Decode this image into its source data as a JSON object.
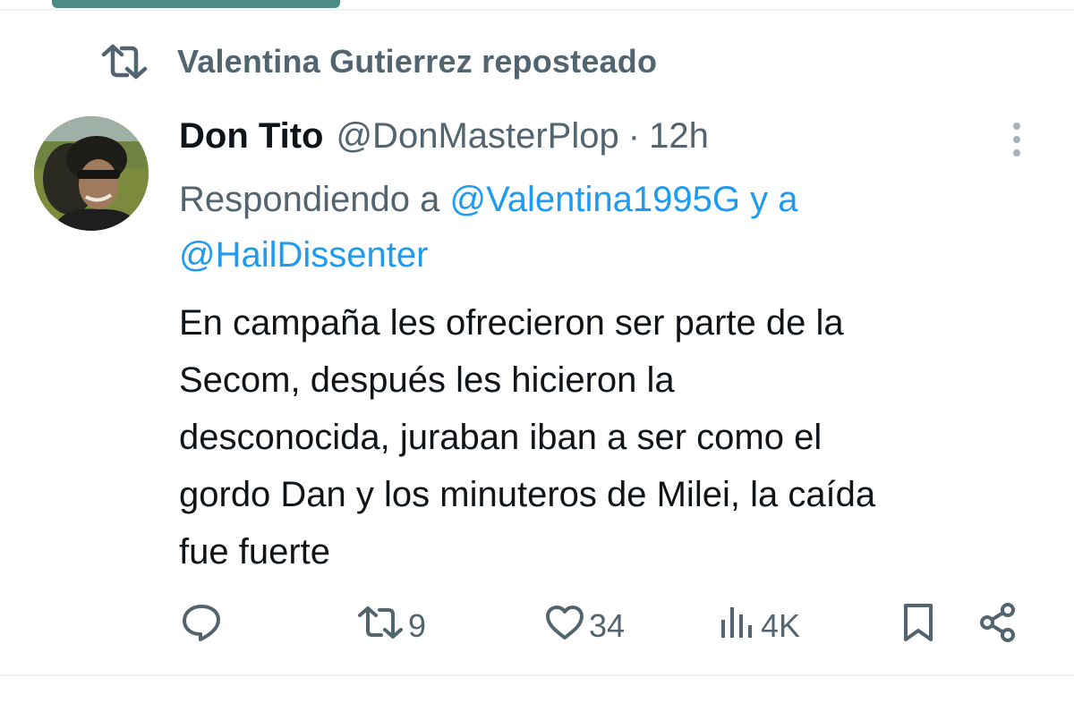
{
  "repost": {
    "icon": "repost-icon",
    "text": "Valentina Gutierrez reposteado"
  },
  "author": {
    "name": "Don Tito",
    "handle": "@DonMasterPlop",
    "separator": "·",
    "time": "12h"
  },
  "reply_context": {
    "prefix": "Respondiendo a ",
    "mention1": "@Valentina1995G",
    "joiner": " y a",
    "mention2": "@HailDissenter"
  },
  "tweet": {
    "lines": [
      "En campaña les ofrecieron ser parte de la",
      "Secom, después les hicieron la",
      "desconocida, juraban iban a ser como el",
      "gordo Dan y los minuteros de Milei, la caída",
      "fue fuerte"
    ]
  },
  "actions": {
    "reply": {
      "icon": "reply-icon",
      "count": ""
    },
    "retweet": {
      "icon": "retweet-icon",
      "count": "9"
    },
    "like": {
      "icon": "heart-icon",
      "count": "34"
    },
    "views": {
      "icon": "views-icon",
      "count": "4K"
    },
    "bookmark": {
      "icon": "bookmark-icon"
    },
    "share": {
      "icon": "share-icon"
    }
  },
  "colors": {
    "text": "#0f1419",
    "secondary": "#536471",
    "link": "#1d9bf0",
    "accent_bar": "#4d8b86"
  }
}
